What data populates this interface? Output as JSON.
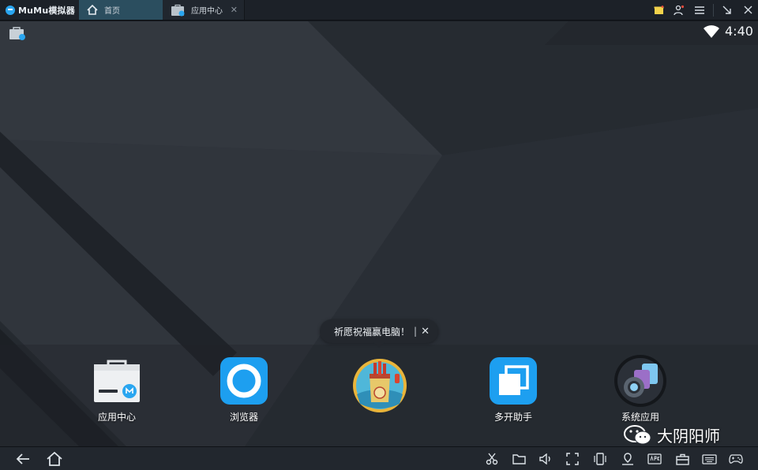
{
  "window": {
    "brand": "MuMu模拟器",
    "tabs": [
      {
        "label": "首页",
        "icon": "home-icon",
        "active": true
      },
      {
        "label": "应用中心",
        "icon": "app-store-icon",
        "active": false
      }
    ],
    "controls": [
      "notification-icon",
      "user-icon",
      "menu-icon",
      "collapse-icon",
      "close-icon"
    ]
  },
  "status_bar": {
    "time": "4:40",
    "wifi": "wifi-icon",
    "store": "store-icon"
  },
  "toast": {
    "text": "祈愿祝福赢电脑！",
    "separator": "|",
    "close": "✕"
  },
  "dock": [
    {
      "label": "应用中心",
      "icon": "app-center-icon"
    },
    {
      "label": "浏览器",
      "icon": "browser-icon"
    },
    {
      "label": "",
      "icon": "game-event-icon"
    },
    {
      "label": "多开助手",
      "icon": "multi-instance-icon"
    },
    {
      "label": "系统应用",
      "icon": "system-apps-icon"
    }
  ],
  "watermark": {
    "text": "大阴阳师"
  },
  "navbar": {
    "left": [
      "back-icon",
      "home-icon"
    ],
    "tools": [
      "scissors-icon",
      "folder-icon",
      "volume-icon",
      "fullscreen-icon",
      "rotate-icon",
      "location-icon",
      "apk-icon",
      "toolbox-icon",
      "keyboard-icon",
      "gamepad-icon"
    ]
  },
  "colors": {
    "accent": "#2aa6f0",
    "tab_active": "#2b4e5f",
    "desktop": "#2c3139"
  }
}
